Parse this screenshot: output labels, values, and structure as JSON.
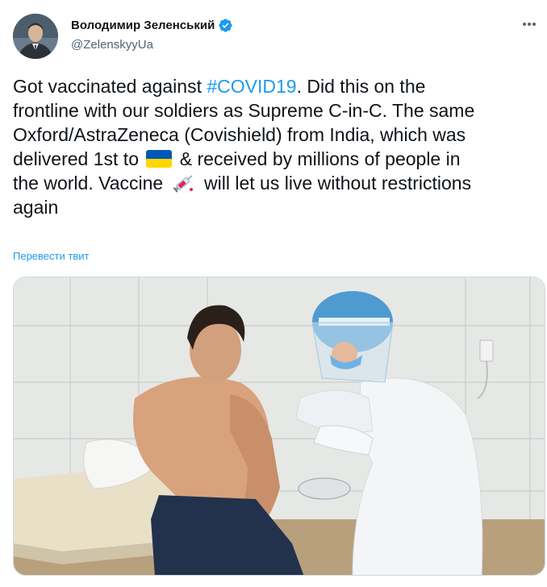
{
  "author": {
    "display_name": "Володимир Зеленський",
    "handle": "@ZelenskyyUa",
    "verified": true
  },
  "tweet": {
    "lines": [
      [
        "Got vaccinated against ",
        "#COVID19",
        ". Did this on the"
      ],
      "frontline with our soldiers as Supreme C-in-C. The same",
      "Oxford/AstraZeneca (Covishield) from India, which was",
      [
        "delivered 1st to ",
        "[flag-ua]",
        " & received by millions of people in"
      ],
      [
        "the world. Vaccine ",
        "[syringe]",
        " will let us live without restrictions"
      ],
      "again"
    ],
    "hashtag": "#COVID19",
    "translate_label": "Перевести твит"
  },
  "icons": {
    "avatar": "avatar",
    "verified": "verified-badge-icon",
    "more": "more-options-icon",
    "flag": "ukraine-flag-emoji",
    "syringe": "syringe-emoji"
  },
  "colors": {
    "link": "#1d9bf0",
    "text": "#0f1419",
    "secondary": "#536471",
    "flag_blue": "#0057b7",
    "flag_yellow": "#ffd700"
  }
}
